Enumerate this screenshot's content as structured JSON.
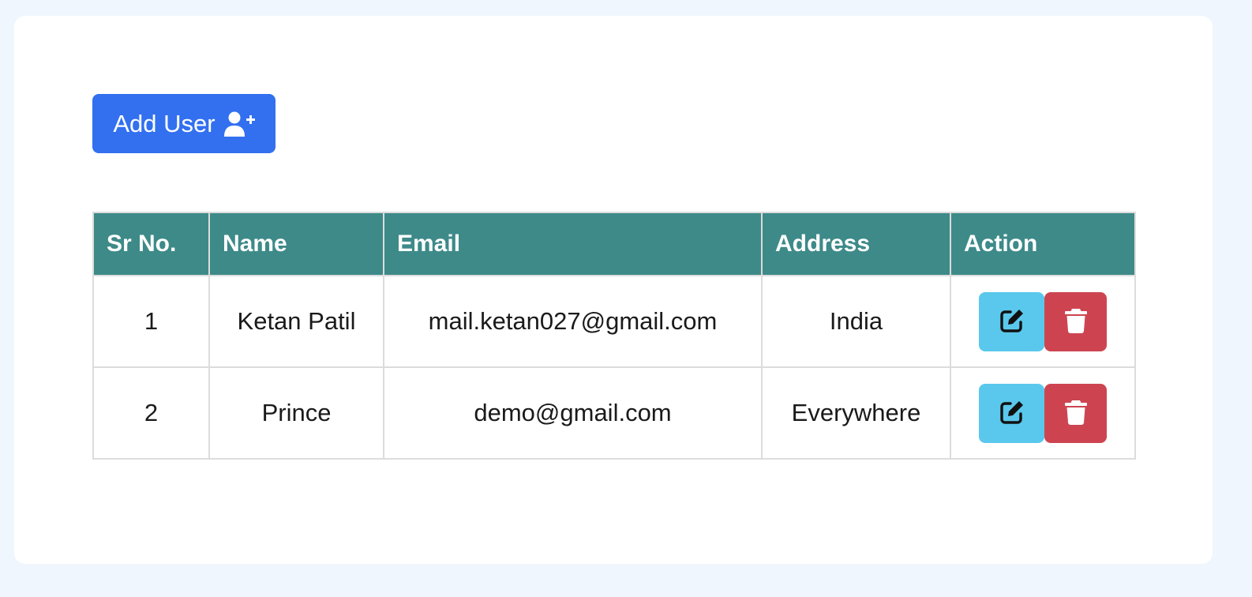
{
  "toolbar": {
    "add_user_label": "Add User",
    "add_user_icon": "user-plus-icon"
  },
  "colors": {
    "page_background": "#f0f6fd",
    "card_background": "#ffffff",
    "primary": "#3270f0",
    "table_header": "#3d8a89",
    "edit": "#5ac8ec",
    "delete": "#cd4450"
  },
  "table": {
    "columns": [
      "Sr No.",
      "Name",
      "Email",
      "Address",
      "Action"
    ],
    "rows": [
      {
        "sr": "1",
        "name": "Ketan Patil",
        "email": "mail.ketan027@gmail.com",
        "address": "India",
        "actions": [
          "edit-icon",
          "trash-icon"
        ]
      },
      {
        "sr": "2",
        "name": "Prince",
        "email": "demo@gmail.com",
        "address": "Everywhere",
        "actions": [
          "edit-icon",
          "trash-icon"
        ]
      }
    ]
  }
}
